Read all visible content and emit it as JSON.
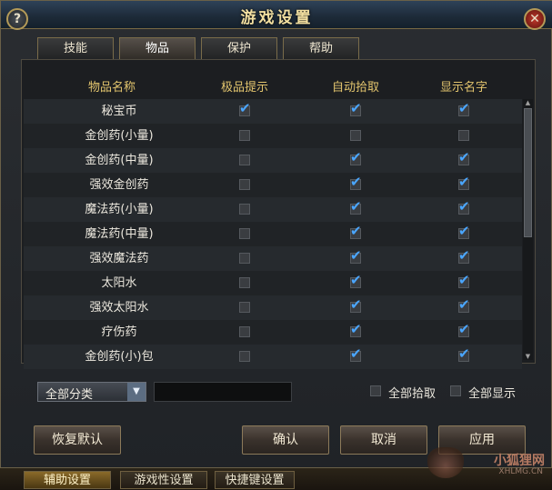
{
  "window": {
    "title": "游戏设置",
    "help_label": "?",
    "close_label": "✕"
  },
  "tabs": [
    {
      "label": "技能",
      "active": false
    },
    {
      "label": "物品",
      "active": true
    },
    {
      "label": "保护",
      "active": false
    },
    {
      "label": "帮助",
      "active": false
    }
  ],
  "table": {
    "headers": [
      "物品名称",
      "极品提示",
      "自动拾取",
      "显示名字"
    ],
    "rows": [
      {
        "name": "秘宝币",
        "rare": true,
        "pickup": true,
        "show": true
      },
      {
        "name": "金创药(小量)",
        "rare": false,
        "pickup": false,
        "show": false
      },
      {
        "name": "金创药(中量)",
        "rare": false,
        "pickup": true,
        "show": true
      },
      {
        "name": "强效金创药",
        "rare": false,
        "pickup": true,
        "show": true
      },
      {
        "name": "魔法药(小量)",
        "rare": false,
        "pickup": true,
        "show": true
      },
      {
        "name": "魔法药(中量)",
        "rare": false,
        "pickup": true,
        "show": true
      },
      {
        "name": "强效魔法药",
        "rare": false,
        "pickup": true,
        "show": true
      },
      {
        "name": "太阳水",
        "rare": false,
        "pickup": true,
        "show": true
      },
      {
        "name": "强效太阳水",
        "rare": false,
        "pickup": true,
        "show": true
      },
      {
        "name": "疗伤药",
        "rare": false,
        "pickup": true,
        "show": true
      },
      {
        "name": "金创药(小)包",
        "rare": false,
        "pickup": true,
        "show": true
      }
    ]
  },
  "filter": {
    "category_selected": "全部分类",
    "search_value": ""
  },
  "options": {
    "pickup_all_label": "全部拾取",
    "pickup_all_checked": false,
    "show_all_label": "全部显示",
    "show_all_checked": false
  },
  "buttons": {
    "restore_default": "恢复默认",
    "confirm": "确认",
    "cancel": "取消",
    "apply": "应用"
  },
  "bottom_tabs": [
    {
      "label": "辅助设置",
      "active": true
    },
    {
      "label": "游戏性设置",
      "active": false
    },
    {
      "label": "快捷键设置",
      "active": false
    }
  ],
  "watermark": {
    "text": "小狐狸网",
    "sub": "XHLMG.CN"
  },
  "colors": {
    "header_text": "#e3c56e",
    "checkmark": "#4aa6ff",
    "title_text": "#f2dfa0"
  }
}
